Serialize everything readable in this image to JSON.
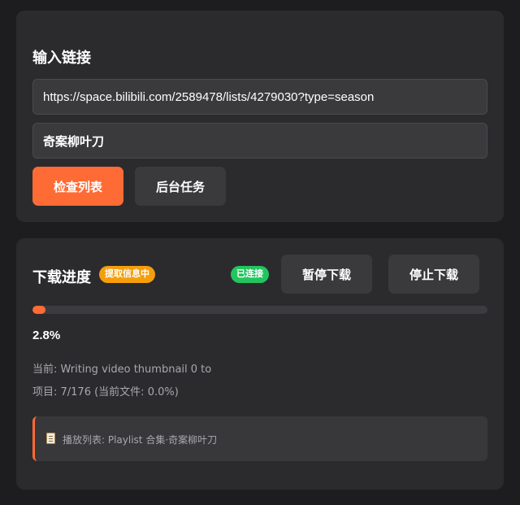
{
  "input_section": {
    "title": "输入链接",
    "url_value": "https://space.bilibili.com/2589478/lists/4279030?type=season",
    "name_value": "奇案柳叶刀",
    "check_button": "检查列表",
    "background_button": "后台任务"
  },
  "progress_section": {
    "title": "下载进度",
    "status_badge": "提取信息中",
    "connection_badge": "已连接",
    "pause_button": "暂停下载",
    "stop_button": "停止下载",
    "progress_fraction": 0.028,
    "percent_text": "2.8%",
    "current_line": "当前: Writing video thumbnail 0 to",
    "item_line": "项目: 7/176 (当前文件: 0.0%)",
    "playlist_icon": "clipboard-icon",
    "playlist_line": "播放列表: Playlist 合集·奇案柳叶刀"
  },
  "colors": {
    "accent": "#ff6b35",
    "warning": "#f59e0b",
    "success": "#22c55e",
    "card": "#2b2b2e",
    "background": "#1d1d1f"
  }
}
